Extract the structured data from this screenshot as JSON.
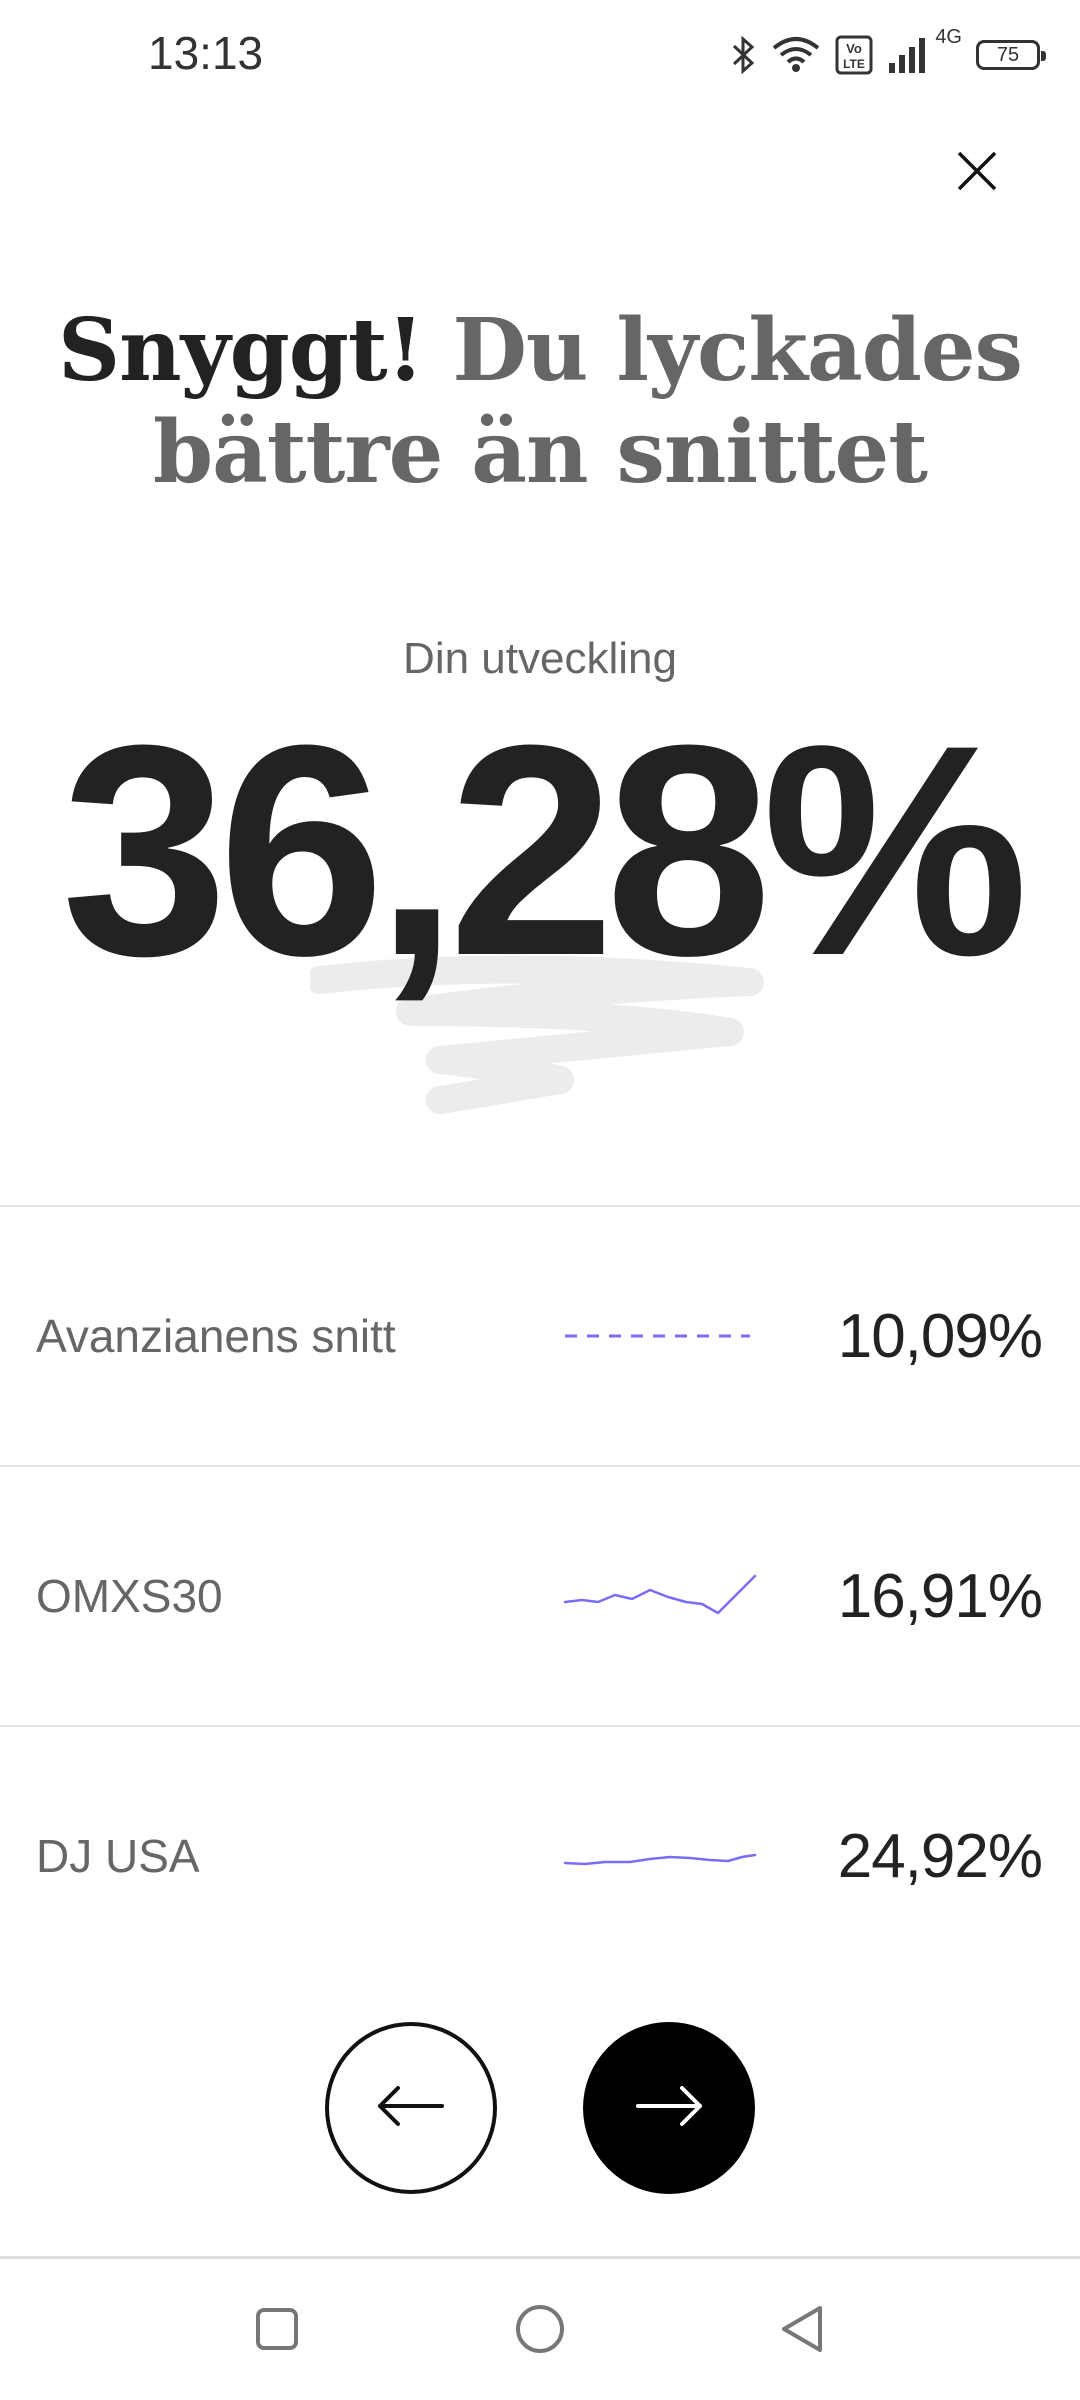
{
  "status_bar": {
    "time": "13:13",
    "network": "4G",
    "volte": "Vo LTE",
    "battery": "75"
  },
  "icons": {
    "close": "close-icon",
    "back_arrow": "arrow-left-icon",
    "next_arrow": "arrow-right-icon",
    "bluetooth": "bluetooth-icon",
    "wifi": "wifi-icon",
    "signal": "signal-icon",
    "battery": "battery-icon"
  },
  "headline": {
    "part1": "Snyggt!",
    "part2": "Du lyckades bättre än snittet"
  },
  "development": {
    "label": "Din utveckling",
    "value": "36,28%"
  },
  "comparisons": [
    {
      "label": "Avanzianens snitt",
      "value": "10,09%",
      "spark_style": "dashed"
    },
    {
      "label": "OMXS30",
      "value": "16,91%",
      "spark_style": "line"
    },
    {
      "label": "DJ USA",
      "value": "24,92%",
      "spark_style": "line"
    }
  ],
  "colors": {
    "accent": "#7b6cf6",
    "text_dark": "#222222",
    "text_muted": "#666666",
    "divider": "#e6e6e6"
  }
}
